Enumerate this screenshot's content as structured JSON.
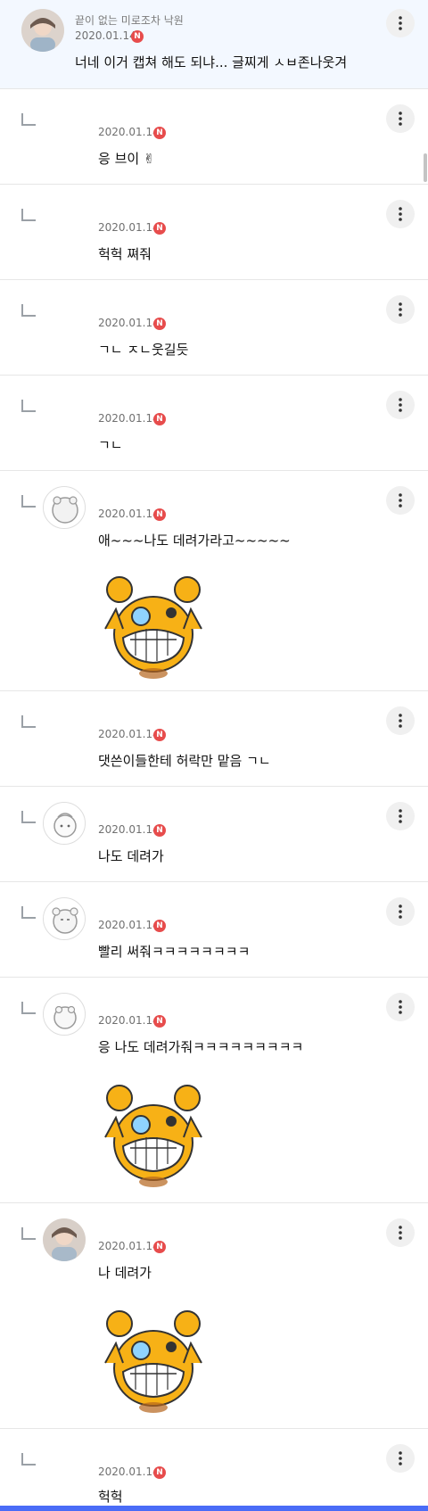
{
  "thread": {
    "post": {
      "author": "끝이 없는 미로조차 낙원",
      "date": "2020.01.14",
      "badge": "N",
      "text": "너네 이거 캡쳐 해도 되냐... 글찌게 ㅅㅂ존나웃겨"
    },
    "replies": [
      {
        "date": "2020.01.14",
        "badge": "N",
        "text": "응 브이 ✌"
      },
      {
        "date": "2020.01.14",
        "badge": "N",
        "text": "헉헉 쪄줘"
      },
      {
        "date": "2020.01.14",
        "badge": "N",
        "text": "ㄱㄴ ㅈㄴ웃길듯"
      },
      {
        "date": "2020.01.14",
        "badge": "N",
        "text": "ㄱㄴ"
      },
      {
        "date": "2020.01.14",
        "badge": "N",
        "text": "애~~~나도 데려가라고~~~~~"
      },
      {
        "date": "2020.01.14",
        "badge": "N",
        "text": "댓쓴이들한테 허락만 맡음 ㄱㄴ"
      },
      {
        "date": "2020.01.14",
        "badge": "N",
        "text": "나도 데려가"
      },
      {
        "date": "2020.01.14",
        "badge": "N",
        "text": "빨리 써줘ㅋㅋㅋㅋㅋㅋㅋㅋ"
      },
      {
        "date": "2020.01.14",
        "badge": "N",
        "text": "응 나도 데려가줘ㅋㅋㅋㅋㅋㅋㅋㅋㅋ"
      },
      {
        "date": "2020.01.14",
        "badge": "N",
        "text": "나 데려가"
      },
      {
        "date": "2020.01.14",
        "badge": "N",
        "text": "헉헉"
      }
    ]
  },
  "icons": {
    "more": "more-vertical-icon",
    "reply": "reply-indent-icon",
    "sticker": "bear-sticker",
    "badge_color": "#e74c4c",
    "accent": "#4a6cf7"
  }
}
